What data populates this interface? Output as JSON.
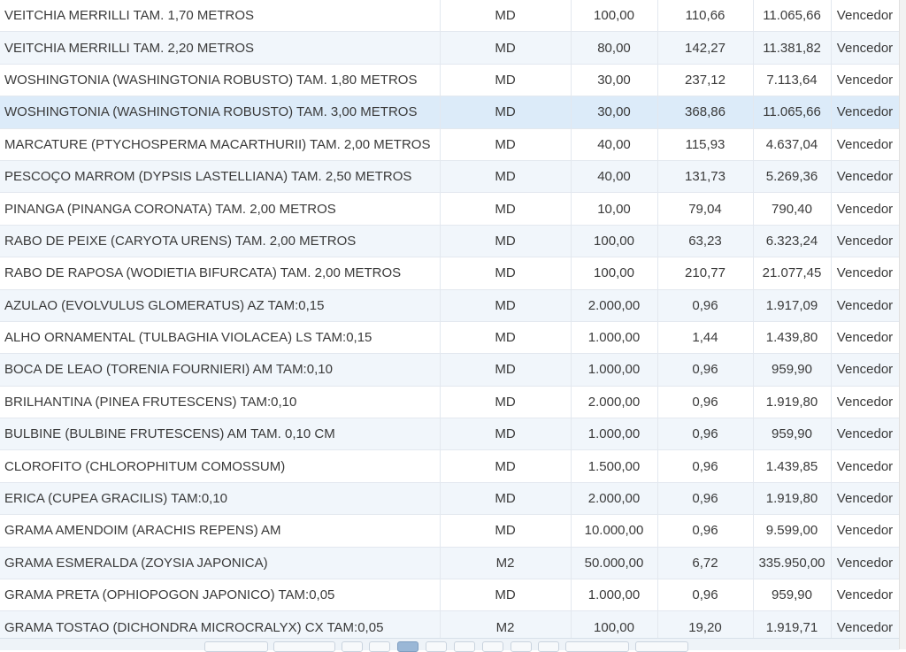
{
  "rows": [
    {
      "desc": "VEITCHIA MERRILLI TAM. 1,70 METROS",
      "unit": "MD",
      "qty": "100,00",
      "price": "110,66",
      "total": "11.065,66",
      "status": "Vencedor"
    },
    {
      "desc": "VEITCHIA MERRILLI TAM. 2,20 METROS",
      "unit": "MD",
      "qty": "80,00",
      "price": "142,27",
      "total": "11.381,82",
      "status": "Vencedor"
    },
    {
      "desc": "WOSHINGTONIA (WASHINGTONIA ROBUSTO) TAM. 1,80 METROS",
      "unit": "MD",
      "qty": "30,00",
      "price": "237,12",
      "total": "7.113,64",
      "status": "Vencedor"
    },
    {
      "desc": "WOSHINGTONIA (WASHINGTONIA ROBUSTO) TAM. 3,00 METROS",
      "unit": "MD",
      "qty": "30,00",
      "price": "368,86",
      "total": "11.065,66",
      "status": "Vencedor"
    },
    {
      "desc": "MARCATURE (PTYCHOSPERMA MACARTHURII) TAM. 2,00 METROS",
      "unit": "MD",
      "qty": "40,00",
      "price": "115,93",
      "total": "4.637,04",
      "status": "Vencedor"
    },
    {
      "desc": "PESCOÇO MARROM (DYPSIS LASTELLIANA) TAM. 2,50 METROS",
      "unit": "MD",
      "qty": "40,00",
      "price": "131,73",
      "total": "5.269,36",
      "status": "Vencedor"
    },
    {
      "desc": "PINANGA (PINANGA CORONATA) TAM. 2,00 METROS",
      "unit": "MD",
      "qty": "10,00",
      "price": "79,04",
      "total": "790,40",
      "status": "Vencedor"
    },
    {
      "desc": "RABO DE PEIXE (CARYOTA URENS) TAM. 2,00 METROS",
      "unit": "MD",
      "qty": "100,00",
      "price": "63,23",
      "total": "6.323,24",
      "status": "Vencedor"
    },
    {
      "desc": "RABO DE RAPOSA (WODIETIA BIFURCATA) TAM. 2,00 METROS",
      "unit": "MD",
      "qty": "100,00",
      "price": "210,77",
      "total": "21.077,45",
      "status": "Vencedor"
    },
    {
      "desc": "AZULAO (EVOLVULUS GLOMERATUS) AZ TAM:0,15",
      "unit": "MD",
      "qty": "2.000,00",
      "price": "0,96",
      "total": "1.917,09",
      "status": "Vencedor"
    },
    {
      "desc": "ALHO ORNAMENTAL (TULBAGHIA VIOLACEA) LS TAM:0,15",
      "unit": "MD",
      "qty": "1.000,00",
      "price": "1,44",
      "total": "1.439,80",
      "status": "Vencedor"
    },
    {
      "desc": "BOCA DE LEAO (TORENIA FOURNIERI) AM TAM:0,10",
      "unit": "MD",
      "qty": "1.000,00",
      "price": "0,96",
      "total": "959,90",
      "status": "Vencedor"
    },
    {
      "desc": "BRILHANTINA (PINEA FRUTESCENS) TAM:0,10",
      "unit": "MD",
      "qty": "2.000,00",
      "price": "0,96",
      "total": "1.919,80",
      "status": "Vencedor"
    },
    {
      "desc": "BULBINE (BULBINE FRUTESCENS) AM TAM. 0,10 CM",
      "unit": "MD",
      "qty": "1.000,00",
      "price": "0,96",
      "total": "959,90",
      "status": "Vencedor"
    },
    {
      "desc": "CLOROFITO (CHLOROPHITUM COMOSSUM)",
      "unit": "MD",
      "qty": "1.500,00",
      "price": "0,96",
      "total": "1.439,85",
      "status": "Vencedor"
    },
    {
      "desc": "ERICA (CUPEA GRACILIS) TAM:0,10",
      "unit": "MD",
      "qty": "2.000,00",
      "price": "0,96",
      "total": "1.919,80",
      "status": "Vencedor"
    },
    {
      "desc": "GRAMA AMENDOIM (ARACHIS REPENS) AM",
      "unit": "MD",
      "qty": "10.000,00",
      "price": "0,96",
      "total": "9.599,00",
      "status": "Vencedor"
    },
    {
      "desc": "GRAMA ESMERALDA (ZOYSIA JAPONICA)",
      "unit": "M2",
      "qty": "50.000,00",
      "price": "6,72",
      "total": "335.950,00",
      "status": "Vencedor"
    },
    {
      "desc": "GRAMA PRETA (OPHIOPOGON JAPONICO) TAM:0,05",
      "unit": "MD",
      "qty": "1.000,00",
      "price": "0,96",
      "total": "959,90",
      "status": "Vencedor"
    },
    {
      "desc": "GRAMA TOSTAO (DICHONDRA MICROCRALYX) CX TAM:0,05",
      "unit": "M2",
      "qty": "100,00",
      "price": "19,20",
      "total": "1.919,71",
      "status": "Vencedor"
    }
  ],
  "colors": {
    "row_even": "#ffffff",
    "row_odd": "#f1f6fb",
    "row_selected": "#dcebf9",
    "grid_line": "#e3e8ef",
    "pager_active": "#9ab7d6"
  }
}
